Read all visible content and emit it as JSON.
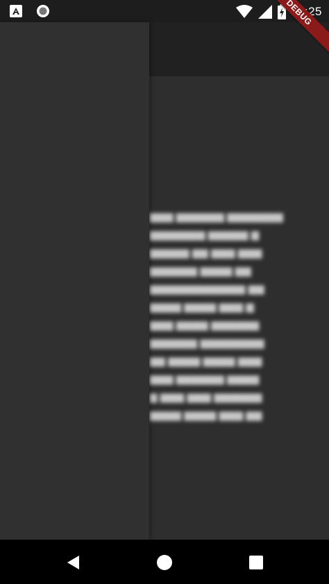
{
  "status_bar": {
    "time": "11:25",
    "icons": [
      "a-notification-icon",
      "record-circle-icon",
      "wifi-icon",
      "signal-icon",
      "battery-charging-icon"
    ]
  },
  "debug_banner": {
    "label": "DEBUG"
  },
  "navigation_bar": {
    "icons": [
      "back-icon",
      "home-icon",
      "recents-icon"
    ]
  },
  "colors": {
    "status_bar_bg": "#1d1d1d",
    "drawer_bg": "#303030",
    "scrim_content_bg": "#2e2e2e",
    "app_bar_bg": "#212121",
    "debug_banner_bg": "#8b1a1a",
    "nav_bar_bg": "#000000"
  }
}
